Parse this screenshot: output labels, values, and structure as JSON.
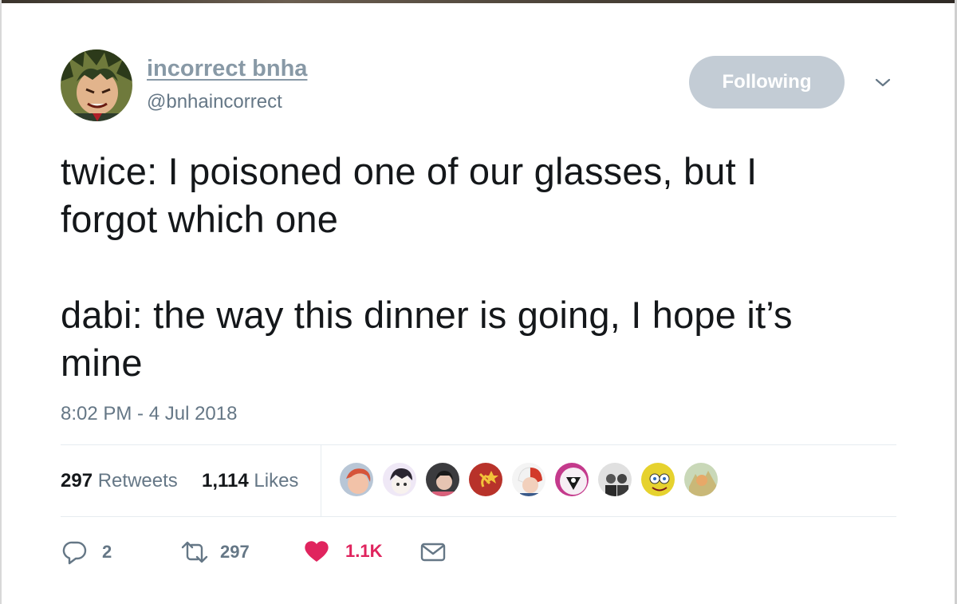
{
  "author": {
    "display_name": "incorrect bnha",
    "handle": "@bnhaincorrect",
    "follow_button_label": "Following",
    "avatar_icon": "avatar-image"
  },
  "tweet": {
    "text": "twice: I poisoned one of our glasses, but I\nforgot which one\n\ndabi: the way this dinner is going, I hope it’s\nmine",
    "timestamp": "8:02 PM - 4 Jul 2018"
  },
  "stats": {
    "retweets_count": "297",
    "retweets_label": "Retweets",
    "likes_count": "1,114",
    "likes_label": "Likes"
  },
  "likers": [
    {
      "icon": "liker-avatar",
      "color": "#f2b8a0"
    },
    {
      "icon": "liker-avatar",
      "color": "#e8e4f2"
    },
    {
      "icon": "liker-avatar",
      "color": "#3a3a3a"
    },
    {
      "icon": "liker-avatar",
      "color": "#b8322a"
    },
    {
      "icon": "liker-avatar",
      "color": "#f4f4f4"
    },
    {
      "icon": "liker-avatar",
      "color": "#c43a8c"
    },
    {
      "icon": "liker-avatar",
      "color": "#8a8a8a"
    },
    {
      "icon": "liker-avatar",
      "color": "#e6d22e"
    },
    {
      "icon": "liker-avatar",
      "color": "#c9b878"
    }
  ],
  "actions": {
    "reply_count": "2",
    "retweet_count": "297",
    "like_count": "1.1K",
    "reply_icon": "reply-icon",
    "retweet_icon": "retweet-icon",
    "like_icon": "heart-icon",
    "dm_icon": "envelope-icon"
  },
  "colors": {
    "like_red": "#e0245e",
    "secondary_gray": "#657786",
    "follow_button_bg": "#c3ccd5"
  }
}
